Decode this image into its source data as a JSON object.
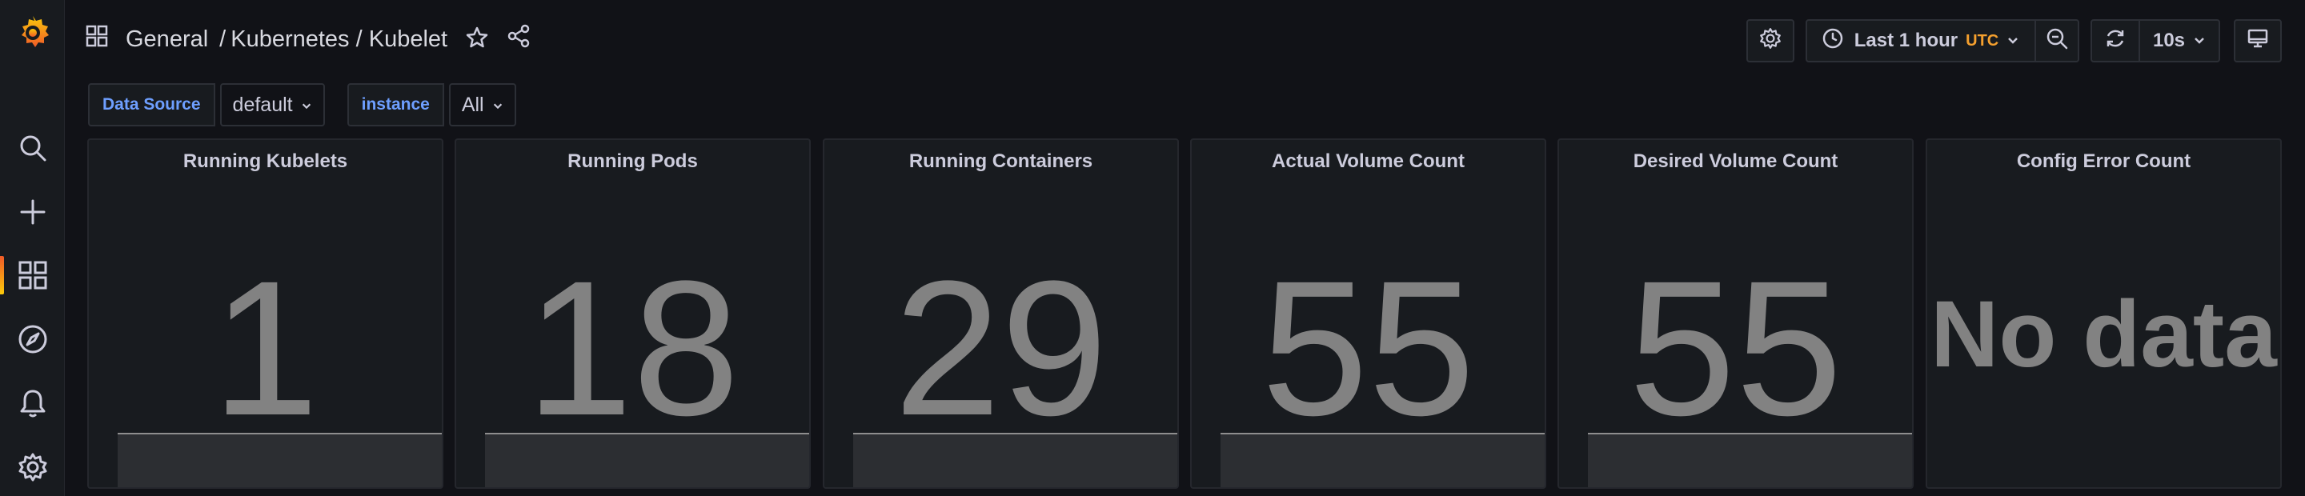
{
  "breadcrumb": {
    "folder": "General",
    "separator": "/",
    "title": "Kubernetes / Kubelet"
  },
  "time_picker": {
    "range_label": "Last 1 hour",
    "timezone": "UTC"
  },
  "refresh": {
    "interval": "10s"
  },
  "variables": [
    {
      "label": "Data Source",
      "value": "default"
    },
    {
      "label": "instance",
      "value": "All"
    }
  ],
  "panels": [
    {
      "title": "Running Kubelets",
      "value": "1"
    },
    {
      "title": "Running Pods",
      "value": "18"
    },
    {
      "title": "Running Containers",
      "value": "29"
    },
    {
      "title": "Actual Volume Count",
      "value": "55"
    },
    {
      "title": "Desired Volume Count",
      "value": "55"
    },
    {
      "title": "Config Error Count",
      "value": "No data"
    }
  ],
  "colors": {
    "background": "#111217",
    "panel": "#181b1f",
    "accent_orange": "#f05a28",
    "variable_label": "#6e9fff",
    "timezone": "#f5a02e",
    "stat_value": "#828282"
  },
  "icons": {
    "sidebar": [
      "grafana-logo-icon",
      "search-icon",
      "plus-icon",
      "dashboards-icon",
      "explore-compass-icon",
      "alert-bell-icon",
      "gear-icon"
    ],
    "topbar": [
      "apps-icon",
      "star-icon",
      "share-icon",
      "settings-icon",
      "clock-icon",
      "zoom-out-icon",
      "refresh-icon",
      "tv-mode-icon"
    ]
  }
}
